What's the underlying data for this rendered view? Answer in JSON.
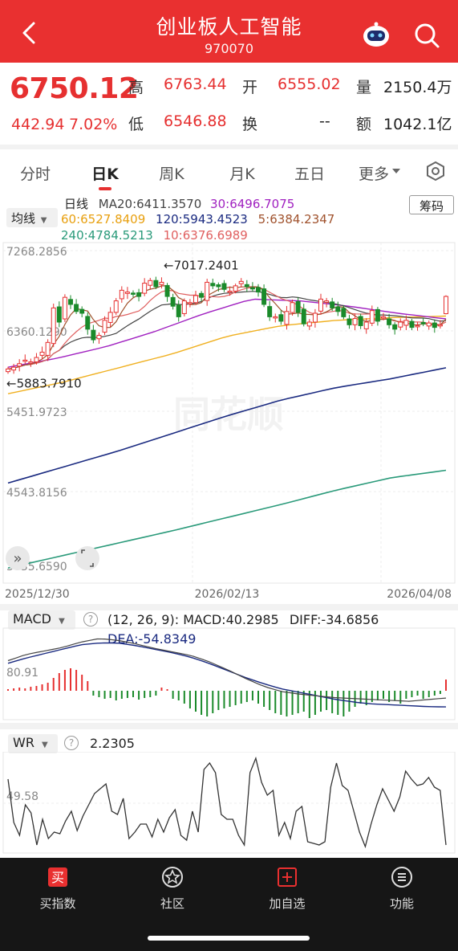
{
  "header": {
    "title": "创业板人工智能",
    "code": "970070"
  },
  "quote": {
    "price": "6750.12",
    "change": "442.94",
    "change_pct": "7.02%",
    "high_label": "高",
    "high": "6763.44",
    "open_label": "开",
    "open": "6555.02",
    "volume_label": "量",
    "volume": "2150.4万",
    "low_label": "低",
    "low": "6546.88",
    "turnover_label": "换",
    "turnover": "--",
    "amount_label": "额",
    "amount": "1042.1亿"
  },
  "tabs": [
    "分时",
    "日K",
    "周K",
    "月K",
    "五日",
    "更多"
  ],
  "active_tab": "日K",
  "kline": {
    "period_label": "日线",
    "ma20": "MA20:6411.3570",
    "ma30": "30:6496.7075",
    "ma60": "60:6527.8409",
    "ma120": "120:5943.4523",
    "ma5": "5:6384.2347",
    "ma240": "240:4784.5213",
    "ma10": "10:6376.6989",
    "junxian_label": "均线",
    "chouma_label": "筹码",
    "y_labels": [
      "7268.2856",
      "6360.1290",
      "5451.9723",
      "4543.8156",
      "3635.6590"
    ],
    "x_labels": [
      "2025/12/30",
      "2026/02/13",
      "2026/04/08"
    ],
    "max_annotation": "←7017.2401",
    "min_annotation": "←5883.7910",
    "watermark": "同花顺"
  },
  "macd": {
    "label": "MACD",
    "params": "(12, 26, 9):",
    "macd": "MACD:40.2985",
    "diff": "DIFF:-34.6856",
    "dea": "DEA:-54.8349",
    "axis": "80.91"
  },
  "wr": {
    "label": "WR",
    "value": "2.2305",
    "axis": "49.58"
  },
  "nav": [
    {
      "label": "买指数",
      "icon": "buy-icon"
    },
    {
      "label": "社区",
      "icon": "community-icon"
    },
    {
      "label": "加自选",
      "icon": "add-watchlist-icon"
    },
    {
      "label": "功能",
      "icon": "menu-icon"
    }
  ],
  "colors": {
    "header": "#e93030",
    "up": "#e63030",
    "down": "#1a8a2a",
    "ma5": "#a0522d",
    "ma10": "#e06060",
    "ma20": "#444444",
    "ma30": "#a020c0",
    "ma60": "#f0b020",
    "ma120": "#1a2a80",
    "ma240": "#2a9a7a"
  },
  "chart_data": [
    {
      "type": "candlestick",
      "title": "创业板人工智能 日线",
      "x_labels": [
        "2025/12/30",
        "2026/02/13",
        "2026/04/08"
      ],
      "ylim": [
        3635.659,
        7268.2856
      ],
      "max_price": 7017.2401,
      "min_price": 5883.791,
      "last": {
        "open": 6555.02,
        "high": 6763.44,
        "low": 6546.88,
        "close": 6750.12
      },
      "ma_last": {
        "MA5": 6384.2347,
        "MA10": 6376.6989,
        "MA20": 6411.357,
        "MA30": 6496.7075,
        "MA60": 6527.8409,
        "MA120": 5943.4523,
        "MA240": 4784.5213
      },
      "closes": [
        5930,
        5950,
        5990,
        6030,
        6010,
        6060,
        6120,
        6230,
        6620,
        6460,
        6740,
        6660,
        6580,
        6560,
        6380,
        6260,
        6310,
        6480,
        6570,
        6700,
        6820,
        6800,
        6780,
        6750,
        6900,
        6930,
        6860,
        6910,
        6750,
        6640,
        6520,
        6700,
        6680,
        6760,
        6740,
        6910,
        6870,
        6860,
        6830,
        6810,
        6870,
        6920,
        6860,
        6840,
        6800,
        6660,
        6520,
        6520,
        6470,
        6580,
        6680,
        6570,
        6440,
        6460,
        6560,
        6720,
        6700,
        6620,
        6580,
        6520,
        6430,
        6500,
        6420,
        6460,
        6590,
        6470,
        6520,
        6430,
        6380,
        6460,
        6480,
        6400,
        6420,
        6440,
        6450,
        6400,
        6430,
        6750.12
      ]
    },
    {
      "type": "bar",
      "title": "MACD (12, 26, 9)",
      "MACD": 40.2985,
      "DIFF": -34.6856,
      "DEA": -54.8349,
      "ymax": 80.91
    },
    {
      "type": "line",
      "title": "WR",
      "value": 2.2305,
      "mid": 49.58
    }
  ]
}
